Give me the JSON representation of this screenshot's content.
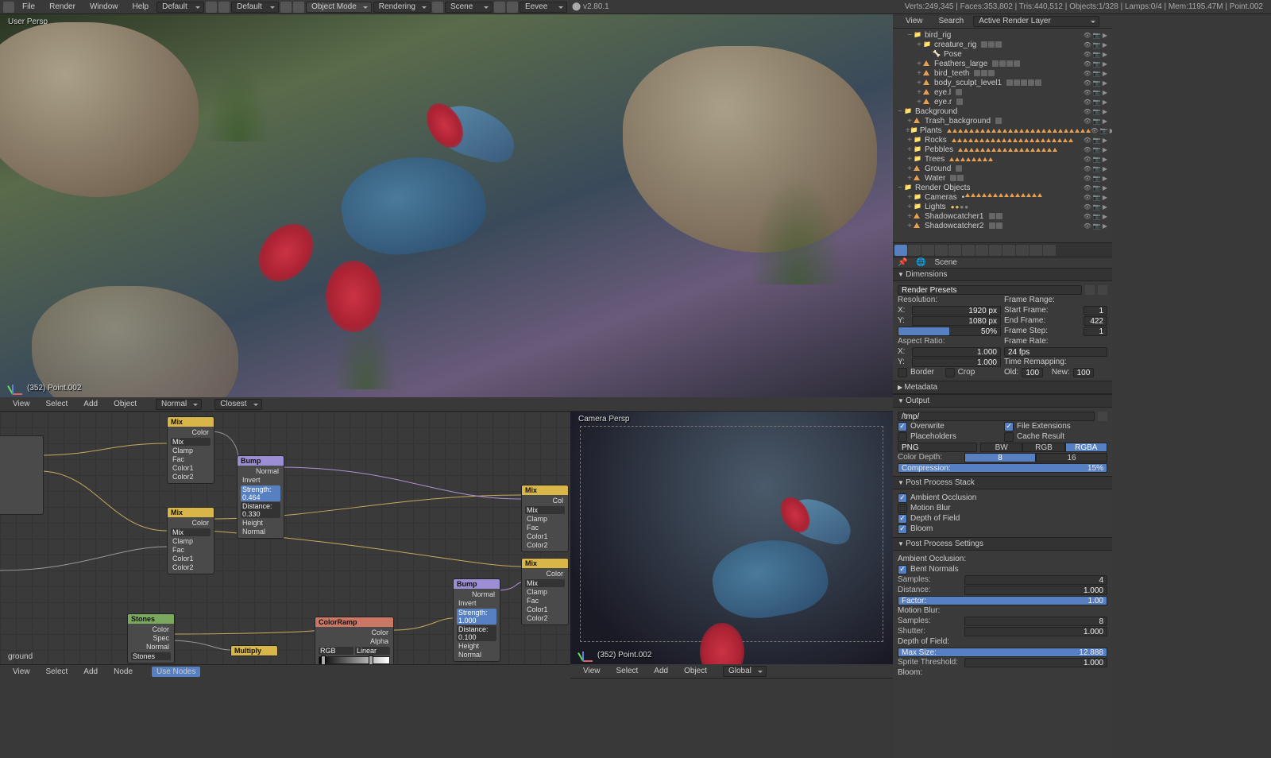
{
  "topbar": {
    "menus": [
      "File",
      "Render",
      "Window",
      "Help"
    ],
    "layout": "Default",
    "scene_dropdown": "Default",
    "mode": "Object Mode",
    "shading": "Rendering",
    "scene": "Scene",
    "engine": "Eevee",
    "version": "v2.80.1",
    "stats": "Verts:249,345 | Faces:353,802 | Tris:440,512 | Objects:1/328 | Lamps:0/4 | Mem:1195.47M | Point.002"
  },
  "viewport": {
    "persp_label": "User Persp",
    "bottom_label": "(352) Point.002"
  },
  "vp_header": {
    "items": [
      "View",
      "Select",
      "Add",
      "Object"
    ],
    "shading": "Normal",
    "snap": "Closest"
  },
  "node_header": {
    "items": [
      "View",
      "Select",
      "Add",
      "Node"
    ],
    "use_nodes": "Use Nodes",
    "material": "ground"
  },
  "cam_vp": {
    "label": "Camera Persp",
    "bottom_label": "(352) Point.002",
    "header_items": [
      "View",
      "Select",
      "Add",
      "Object"
    ],
    "orient": "Global"
  },
  "nodes": {
    "mix1": {
      "title": "Mix",
      "type": "Mix",
      "out": "Color",
      "rows": [
        "Clamp",
        "Fac",
        "Color1",
        "Color2"
      ]
    },
    "mix2": {
      "title": "Mix",
      "type": "Mix",
      "out": "Color",
      "rows": [
        "Clamp",
        "Fac",
        "Color1",
        "Color2"
      ]
    },
    "mix3": {
      "title": "Mix",
      "type": "Mix",
      "out": "Color",
      "rows": [
        "Clamp",
        "Fac",
        "Color1",
        "Color2"
      ]
    },
    "mix4": {
      "title": "Mix",
      "type": "Mix",
      "out": "Color",
      "rows": [
        "Clamp",
        "Fac",
        "Color1",
        "Color2"
      ]
    },
    "bump1": {
      "title": "Bump",
      "out": "Normal",
      "invert": "Invert",
      "strength": "Strength: 0.464",
      "distance": "Distance: 0.330",
      "rows": [
        "Height",
        "Normal"
      ]
    },
    "bump2": {
      "title": "Bump",
      "out": "Normal",
      "invert": "Invert",
      "strength": "Strength: 1.000",
      "distance": "Distance: 0.100",
      "rows": [
        "Height",
        "Normal"
      ]
    },
    "stones": {
      "title": "Stones",
      "rows": [
        "Color",
        "Spec",
        "Normal"
      ],
      "tex": "Stones"
    },
    "multiply": {
      "title": "Multiply"
    },
    "colorramp": {
      "title": "ColorRamp",
      "out": "Color",
      "out2": "Alpha",
      "mode": "RGB",
      "interp": "Linear"
    }
  },
  "outliner": {
    "header": {
      "view": "View",
      "search": "Search",
      "layer": "Active Render Layer"
    },
    "tree": [
      {
        "d": 1,
        "exp": "−",
        "ic": "y",
        "name": "bird_rig"
      },
      {
        "d": 2,
        "exp": "+",
        "ic": "y",
        "name": "creature_rig",
        "extra": 3
      },
      {
        "d": 3,
        "exp": "",
        "ic": "c",
        "name": "Pose"
      },
      {
        "d": 2,
        "exp": "+",
        "ic": "o",
        "name": "Feathers_large",
        "extra": 4
      },
      {
        "d": 2,
        "exp": "+",
        "ic": "o",
        "name": "bird_teeth",
        "extra": 3
      },
      {
        "d": 2,
        "exp": "+",
        "ic": "o",
        "name": "body_sculpt_level1",
        "extra": 5
      },
      {
        "d": 2,
        "exp": "+",
        "ic": "o",
        "name": "eye.l",
        "extra": 1
      },
      {
        "d": 2,
        "exp": "+",
        "ic": "o",
        "name": "eye.r",
        "extra": 1
      },
      {
        "d": 0,
        "exp": "−",
        "ic": "y",
        "name": "Background"
      },
      {
        "d": 1,
        "exp": "+",
        "ic": "o",
        "name": "Trash_background",
        "extra": 1
      },
      {
        "d": 1,
        "exp": "+",
        "ic": "y",
        "name": "Plants",
        "tri": 26
      },
      {
        "d": 1,
        "exp": "+",
        "ic": "y",
        "name": "Rocks",
        "tri": 22
      },
      {
        "d": 1,
        "exp": "+",
        "ic": "y",
        "name": "Pebbles",
        "tri": 18
      },
      {
        "d": 1,
        "exp": "+",
        "ic": "y",
        "name": "Trees",
        "tri": 8
      },
      {
        "d": 1,
        "exp": "+",
        "ic": "o",
        "name": "Ground",
        "extra": 1
      },
      {
        "d": 1,
        "exp": "+",
        "ic": "o",
        "name": "Water",
        "extra": 2
      },
      {
        "d": 0,
        "exp": "−",
        "ic": "y",
        "name": "Render Objects"
      },
      {
        "d": 1,
        "exp": "+",
        "ic": "y",
        "name": "Cameras",
        "dot": 1,
        "tri": 14
      },
      {
        "d": 1,
        "exp": "+",
        "ic": "y",
        "name": "Lights",
        "lamp": 4
      },
      {
        "d": 1,
        "exp": "+",
        "ic": "o",
        "name": "Shadowcatcher1",
        "extra": 2
      },
      {
        "d": 1,
        "exp": "+",
        "ic": "o",
        "name": "Shadowcatcher2",
        "extra": 2
      }
    ]
  },
  "props": {
    "context": "Scene",
    "dimensions": {
      "title": "Dimensions",
      "presets": "Render Presets",
      "res_label": "Resolution:",
      "x": "1920 px",
      "y": "1080 px",
      "pct": "50%",
      "aspect_label": "Aspect Ratio:",
      "ax": "1.000",
      "ay": "1.000",
      "border": "Border",
      "crop": "Crop",
      "frame_range": "Frame Range:",
      "start": "Start Frame:",
      "start_v": "1",
      "end": "End Frame:",
      "end_v": "422",
      "step": "Frame Step:",
      "step_v": "1",
      "rate": "Frame Rate:",
      "rate_v": "24 fps",
      "remap": "Time Remapping:",
      "old": "Old:",
      "old_v": "100",
      "new": "New:",
      "new_v": "100"
    },
    "metadata": {
      "title": "Metadata"
    },
    "output": {
      "title": "Output",
      "path": "/tmp/",
      "overwrite": "Overwrite",
      "placeholders": "Placeholders",
      "file_ext": "File Extensions",
      "cache": "Cache Result",
      "format": "PNG",
      "bw": "BW",
      "rgb": "RGB",
      "rgba": "RGBA",
      "depth_label": "Color Depth:",
      "d8": "8",
      "d16": "16",
      "compression": "Compression:",
      "comp_v": "15%"
    },
    "pps": {
      "title": "Post Process Stack",
      "ao": "Ambient Occlusion",
      "mb": "Motion Blur",
      "dof": "Depth of Field",
      "bloom": "Bloom"
    },
    "ppset": {
      "title": "Post Process Settings",
      "ao_h": "Ambient Occlusion:",
      "bent": "Bent Normals",
      "samples": "Samples:",
      "samples_v": "4",
      "distance": "Distance:",
      "distance_v": "1.000",
      "factor": "Factor:",
      "factor_v": "1.00",
      "mb_h": "Motion Blur:",
      "mb_samples_v": "8",
      "shutter": "Shutter:",
      "shutter_v": "1.000",
      "dof_h": "Depth of Field:",
      "max_size": "Max Size:",
      "max_size_v": "12.888",
      "sprite": "Sprite Threshold:",
      "sprite_v": "1.000",
      "bloom_h": "Bloom:"
    }
  }
}
